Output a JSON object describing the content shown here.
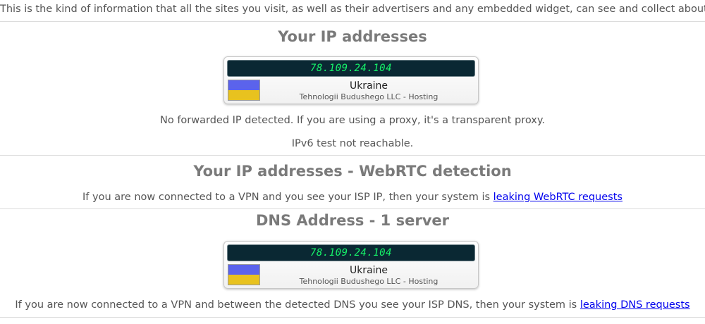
{
  "intro_text": "This is the kind of information that all the sites you visit, as well as their advertisers and any embedded widget, can see and collect about you.",
  "ip_section": {
    "title": "Your IP addresses",
    "ip": "78.109.24.104",
    "country": "Ukraine",
    "isp": "Tehnologii Budushego LLC - Hosting",
    "forwarded_note": "No forwarded IP detected. If you are using a proxy, it's a transparent proxy.",
    "ipv6_note": "IPv6 test not reachable."
  },
  "webrtc_section": {
    "title": "Your IP addresses - WebRTC detection",
    "text": "If you are now connected to a VPN and you see your ISP IP, then your system is",
    "link": "leaking WebRTC requests"
  },
  "dns_section": {
    "title": "DNS Address - 1 server",
    "ip": "78.109.24.104",
    "country": "Ukraine",
    "isp": "Tehnologii Budushego LLC - Hosting",
    "text": "If you are now connected to a VPN and between the detected DNS you see your ISP DNS, then your system is",
    "link": "leaking DNS requests"
  },
  "colors": {
    "flag_blue": "#5b63ec",
    "flag_yellow": "#e8c21f",
    "ip_text": "#16f56a",
    "ip_background": "#0a2833",
    "link": "#0000ee"
  }
}
